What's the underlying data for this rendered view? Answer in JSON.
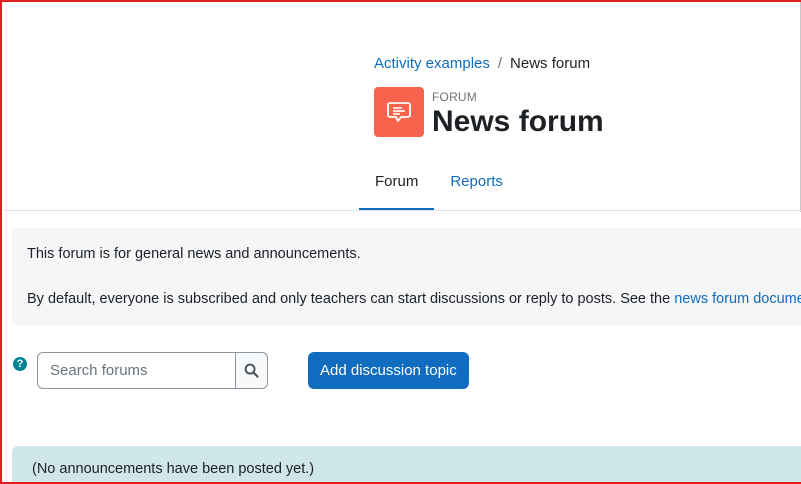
{
  "breadcrumb": {
    "parent": "Activity examples",
    "separator": "/",
    "current": "News forum"
  },
  "header": {
    "icon": "forum-chat-icon",
    "icon_color": "#f7634d",
    "type_label": "FORUM",
    "title": "News forum"
  },
  "tabs": [
    {
      "label": "Forum",
      "active": true
    },
    {
      "label": "Reports",
      "active": false
    }
  ],
  "intro": {
    "line1": "This forum is for general news and announcements.",
    "line2_text": "By default, everyone is subscribed and only teachers can start discussions or reply to posts. See the ",
    "line2_link": "news forum documentation"
  },
  "search": {
    "help_icon": "question-circle-icon",
    "placeholder": "Search forums",
    "button_icon": "search-icon"
  },
  "actions": {
    "add_discussion_label": "Add discussion topic"
  },
  "notice": {
    "text": "(No announcements have been posted yet.)"
  },
  "colors": {
    "accent": "#0f6cbf",
    "frame_border": "#e02020",
    "notice_bg": "#cfe6ea"
  }
}
